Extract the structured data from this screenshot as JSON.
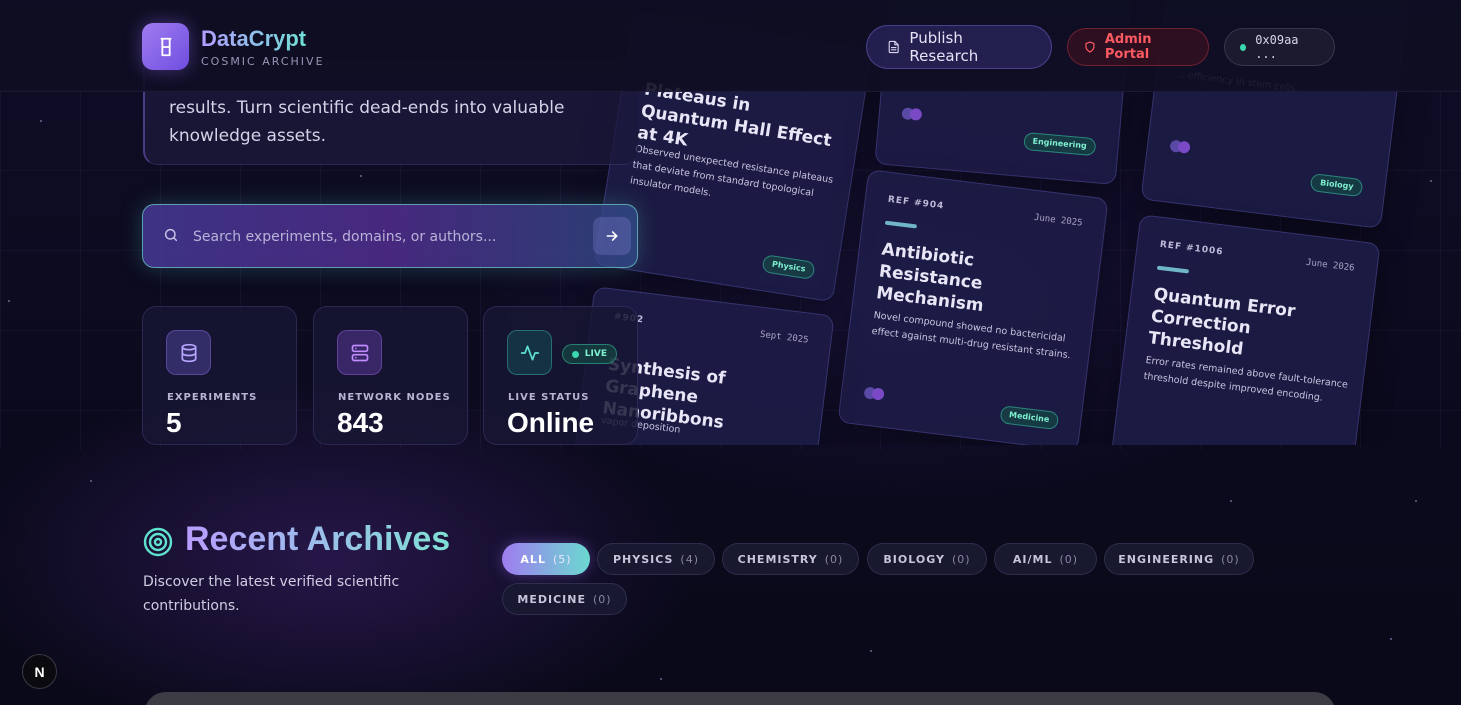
{
  "header": {
    "brand_title": "DataCrypt",
    "brand_subtitle": "COSMIC ARCHIVE",
    "publish_label": "Publish Research",
    "admin_label": "Admin Portal",
    "wallet_address": "0x09aa ...",
    "colors": {
      "accent": "#8b6cf0",
      "teal": "#6fe0d6",
      "danger": "#ff5a62"
    }
  },
  "hero": {
    "intro_text": "results. Turn scientific dead-ends into valuable knowledge assets.",
    "search": {
      "placeholder": "Search experiments, domains, or authors..."
    }
  },
  "stats": [
    {
      "label": "EXPERIMENTS",
      "value": "5",
      "icon": "database-icon"
    },
    {
      "label": "NETWORK NODES",
      "value": "843",
      "icon": "server-icon"
    },
    {
      "label": "LIVE STATUS",
      "value": "Online",
      "icon": "activity-icon",
      "badge": "LIVE"
    }
  ],
  "cards": [
    {
      "title": "Plateaus in Quantum Hall Effect at 4K",
      "desc": "Observed unexpected resistance plateaus that deviate from standard topological insulator models.",
      "tag": "Physics"
    },
    {
      "tag": "Engineering"
    },
    {
      "desc": "...efficiency in stem cells.",
      "tag": "Biology"
    },
    {
      "ref": "REF #904",
      "date": "June 2025",
      "title": "Antibiotic Resistance Mechanism",
      "desc": "Novel compound showed no bactericidal effect against multi-drug resistant strains.",
      "tag": "Medicine"
    },
    {
      "ref": "REF #1006",
      "date": "June 2026",
      "title": "Quantum Error Correction Threshold",
      "desc": "Error rates remained above fault-tolerance threshold despite improved encoding."
    },
    {
      "ref": "#902",
      "date": "Sept 2025",
      "title": "Synthesis of Graphene Nanoribbons",
      "desc": "vapor deposition"
    }
  ],
  "archives": {
    "title": "Recent Archives",
    "subtitle": "Discover the latest verified scientific contributions.",
    "filters": [
      {
        "label": "ALL",
        "count": "(5)"
      },
      {
        "label": "PHYSICS",
        "count": "(4)"
      },
      {
        "label": "CHEMISTRY",
        "count": "(0)"
      },
      {
        "label": "BIOLOGY",
        "count": "(0)"
      },
      {
        "label": "AI/ML",
        "count": "(0)"
      },
      {
        "label": "ENGINEERING",
        "count": "(0)"
      },
      {
        "label": "MEDICINE",
        "count": "(0)"
      }
    ]
  },
  "dev_badge": "N"
}
